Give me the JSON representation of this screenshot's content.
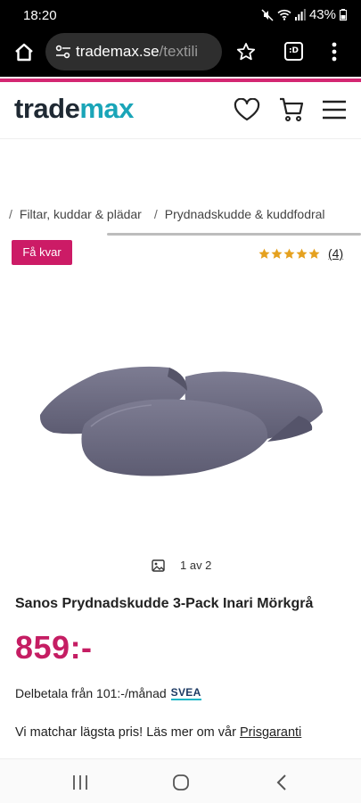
{
  "status_bar": {
    "time": "18:20",
    "battery": "43%"
  },
  "browser": {
    "url_host": "trademax.se",
    "url_path": "/textili",
    "tabs_label": ":D"
  },
  "header": {
    "logo_part1": "trade",
    "logo_part2": "max"
  },
  "breadcrumb": {
    "separator": "/",
    "items": [
      "Filtar, kuddar & plädar",
      "Prydnadskudde & kuddfodral"
    ]
  },
  "badge": "Få kvar",
  "rating": {
    "stars": 5,
    "count": "(4)"
  },
  "gallery": {
    "counter": "1 av 2"
  },
  "product": {
    "title": "Sanos Prydnadskudde 3-Pack Inari Mörkgrå",
    "price": "859:-",
    "installment_text": "Delbetala från 101:-/månad",
    "installment_provider": "SVEA",
    "guarantee_text": "Vi matchar lägsta pris! Läs mer om vår",
    "guarantee_link": "Prisgaranti"
  },
  "colors": {
    "brand_pink": "#c51d63",
    "logo_teal": "#1aa5b8",
    "pillow": "#6b6a80"
  }
}
